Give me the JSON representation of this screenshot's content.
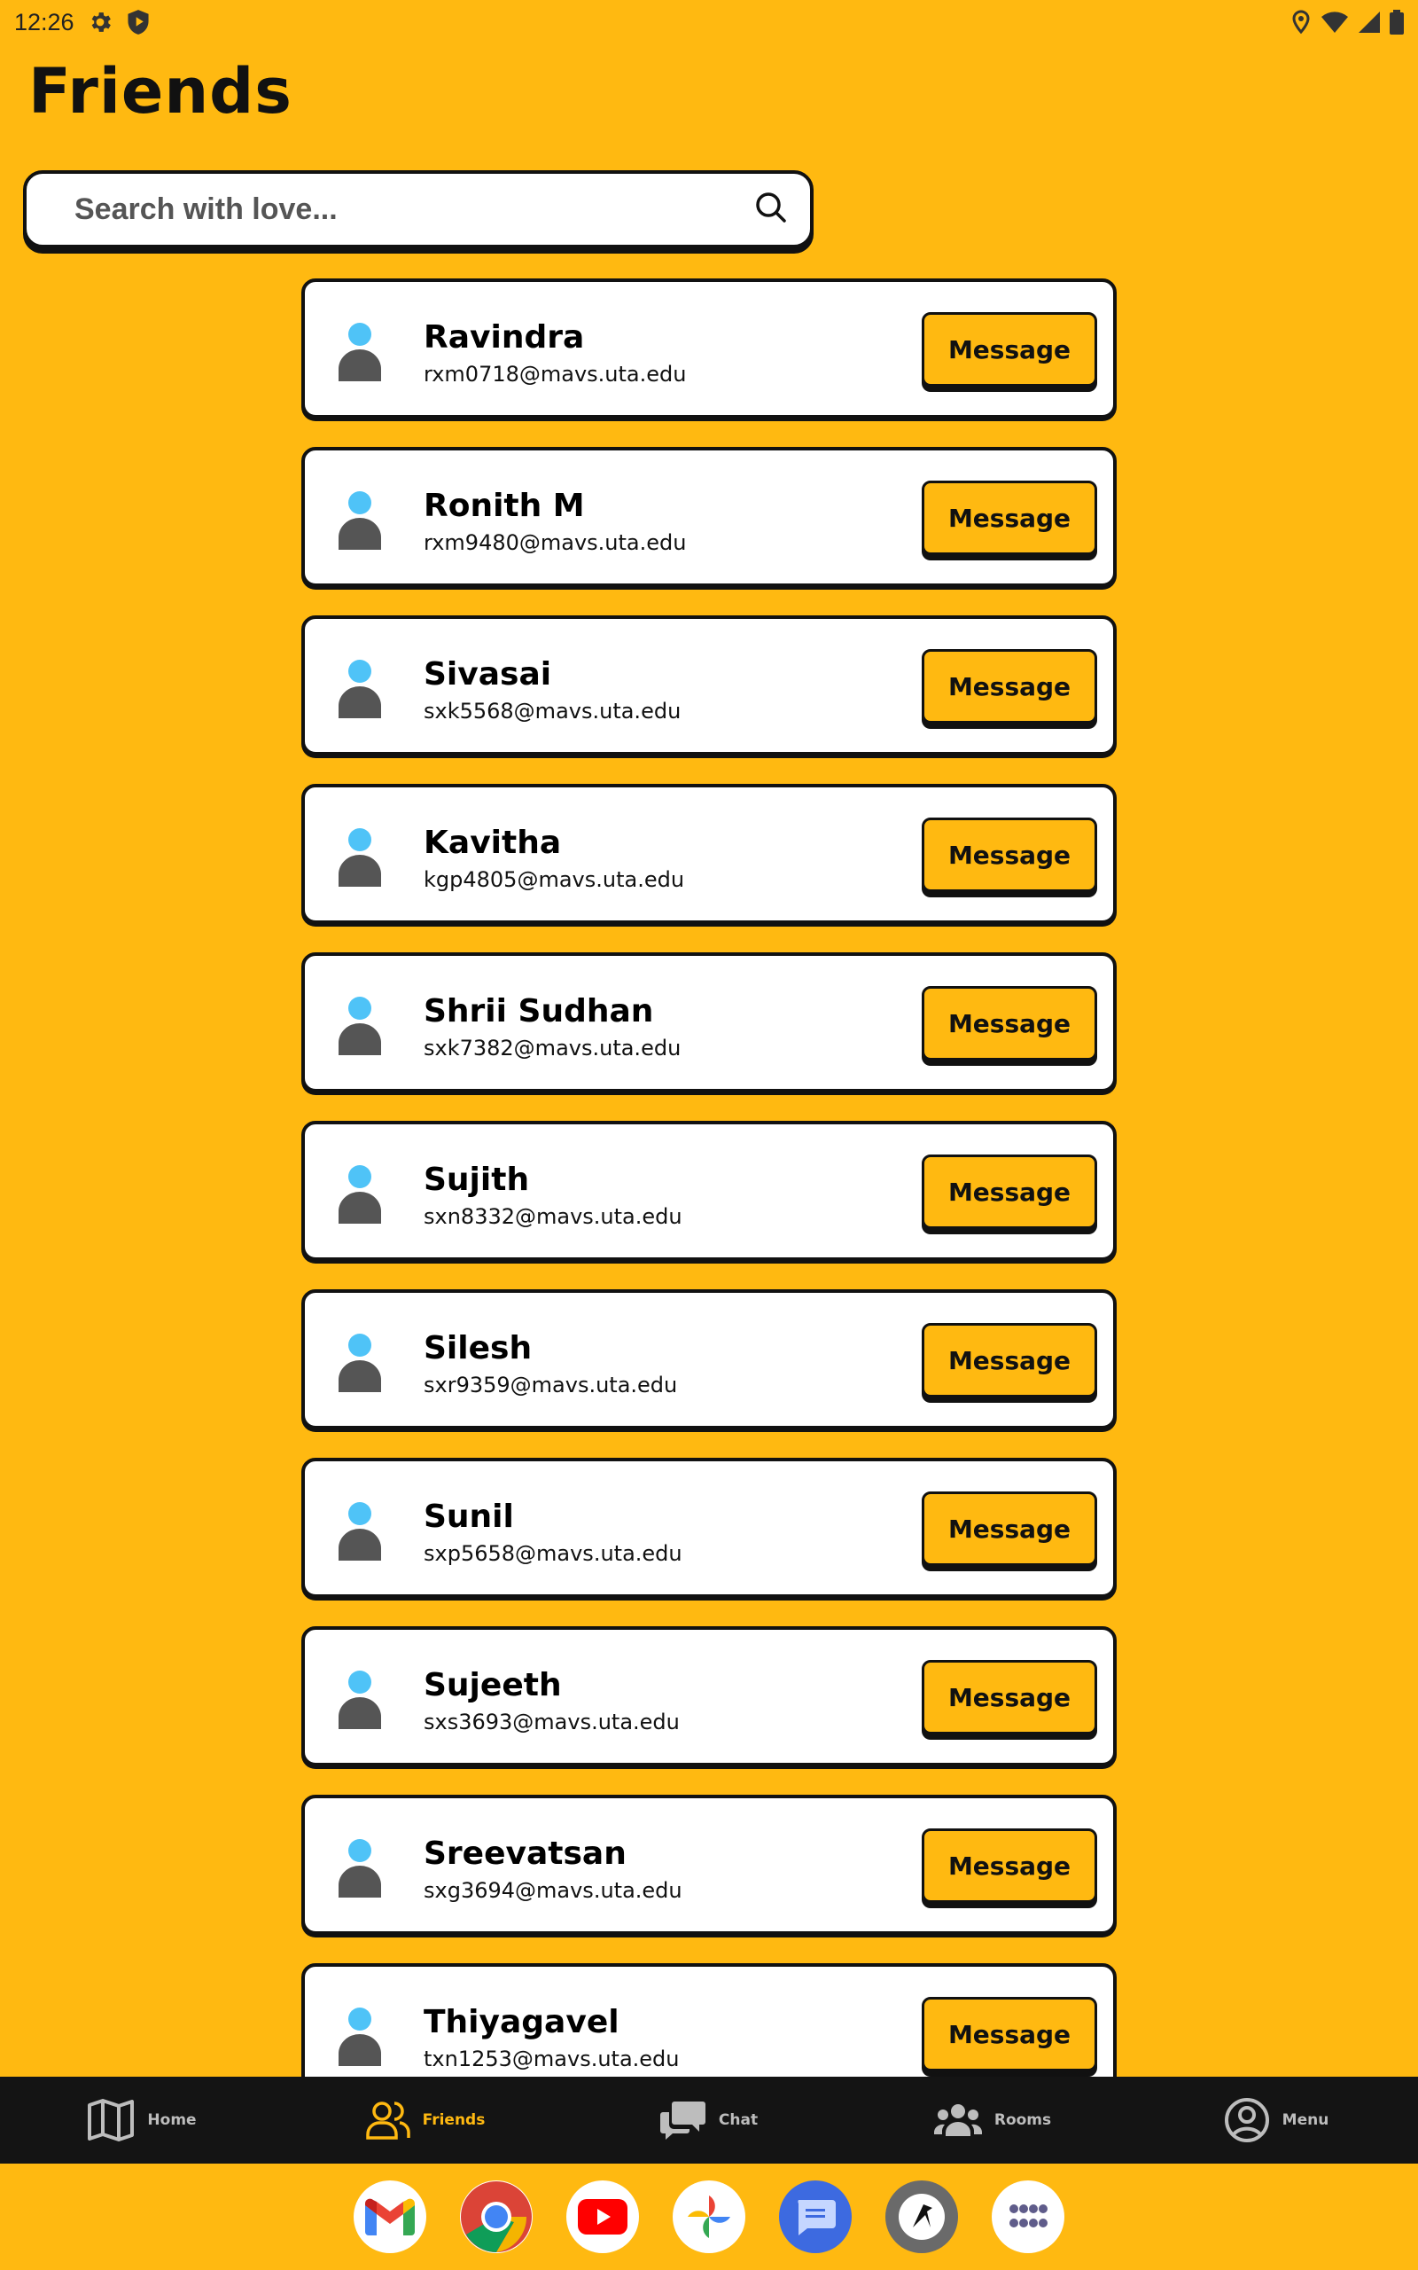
{
  "status_bar": {
    "time": "12:26"
  },
  "page": {
    "title": "Friends"
  },
  "search": {
    "placeholder": "Search with love..."
  },
  "message_label": "Message",
  "friends": [
    {
      "name": "Ravindra",
      "email": "rxm0718@mavs.uta.edu"
    },
    {
      "name": "Ronith M",
      "email": "rxm9480@mavs.uta.edu"
    },
    {
      "name": "Sivasai",
      "email": "sxk5568@mavs.uta.edu"
    },
    {
      "name": "Kavitha",
      "email": "kgp4805@mavs.uta.edu"
    },
    {
      "name": "Shrii Sudhan",
      "email": "sxk7382@mavs.uta.edu"
    },
    {
      "name": "Sujith",
      "email": "sxn8332@mavs.uta.edu"
    },
    {
      "name": "Silesh",
      "email": "sxr9359@mavs.uta.edu"
    },
    {
      "name": "Sunil",
      "email": "sxp5658@mavs.uta.edu"
    },
    {
      "name": "Sujeeth",
      "email": "sxs3693@mavs.uta.edu"
    },
    {
      "name": "Sreevatsan",
      "email": "sxg3694@mavs.uta.edu"
    },
    {
      "name": "Thiyagavel",
      "email": "txn1253@mavs.uta.edu"
    }
  ],
  "bottom_nav": {
    "items": [
      {
        "label": "Home",
        "icon": "map-icon"
      },
      {
        "label": "Friends",
        "icon": "people-icon",
        "active": true
      },
      {
        "label": "Chat",
        "icon": "chat-icon"
      },
      {
        "label": "Rooms",
        "icon": "group-icon"
      },
      {
        "label": "Menu",
        "icon": "account-circle-icon"
      }
    ]
  },
  "dock": {
    "apps": [
      "gmail-icon",
      "chrome-icon",
      "youtube-icon",
      "photos-icon",
      "messages-icon",
      "app-icon",
      "app-drawer-icon"
    ]
  },
  "colors": {
    "accent": "#FFB911",
    "dark": "#111111",
    "nav_bg": "#141414"
  }
}
